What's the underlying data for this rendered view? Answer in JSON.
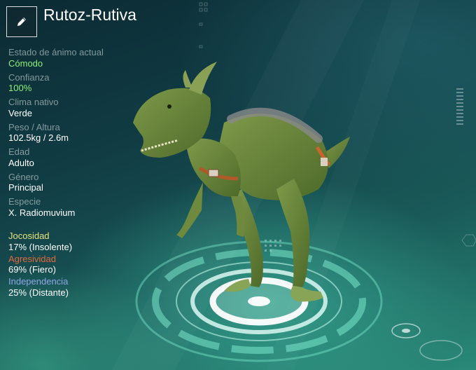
{
  "header": {
    "creature_name": "Rutoz-Rutiva",
    "edit_icon": "pencil-icon"
  },
  "stats": [
    {
      "label": "Estado de ánimo actual",
      "value": "Cómodo",
      "highlight": true
    },
    {
      "label": "Confianza",
      "value": "100%",
      "highlight": true
    },
    {
      "label": "Clima nativo",
      "value": "Verde",
      "highlight": false
    },
    {
      "label": "Peso / Altura",
      "value": "102.5kg / 2.6m",
      "highlight": false
    },
    {
      "label": "Edad",
      "value": "Adulto",
      "highlight": false
    },
    {
      "label": "Género",
      "value": "Principal",
      "highlight": false
    },
    {
      "label": "Especie",
      "value": "X. Radiomuvium",
      "highlight": false
    }
  ],
  "traits": [
    {
      "label": "Jocosidad",
      "value": "17% (Insolente)",
      "color": "#e6e27a"
    },
    {
      "label": "Agresividad",
      "value": "69% (Fiero)",
      "color": "#e0693c"
    },
    {
      "label": "Independencia",
      "value": "25% (Distante)",
      "color": "#8fa6e6"
    }
  ],
  "colors": {
    "accent_green": "#8ef07a",
    "creature_skin": "#6f8a3e"
  }
}
